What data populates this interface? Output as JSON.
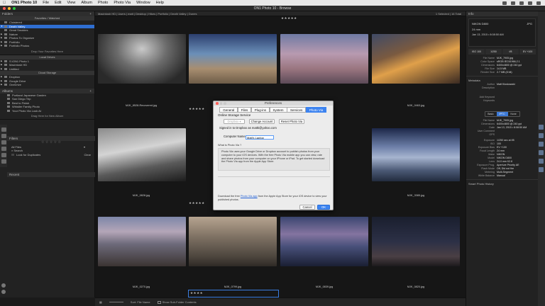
{
  "menubar": {
    "items": [
      "ON1 Photo 10",
      "File",
      "Edit",
      "View",
      "Album",
      "Photo",
      "Photo Via",
      "Window",
      "Help"
    ]
  },
  "window": {
    "title": "ON1 Photo 10 - Browse"
  },
  "left": {
    "folders_title": "Folders",
    "favorites_title": "Favorites / Watched",
    "favorites": [
      "Cloistered",
      "Death Valley",
      "Great Smokies",
      "Nature",
      "Photos To Organize",
      "Portfolio",
      "Portfolio Photos"
    ],
    "favorites_drop": "Drop Your Favorites Here",
    "local_title": "Local Drives",
    "local": [
      "S:\\ON1 Photo 1",
      "Macintosh HD",
      "Untitled"
    ],
    "cloud_title": "Cloud Storage",
    "cloud": [
      "Dropbox",
      "Google Drive",
      "OneDrive"
    ],
    "albums_title": "Albums",
    "albums": [
      "Portland Japanese Garden",
      "San Diego Trip",
      "Best to Finish",
      "Whistler Family Photo",
      "Your Photo Via Look At"
    ],
    "albums_drop": "Drag Here for New Album",
    "filters_title": "Filters",
    "filters_stars": "☆ ☆ ☆ ☆ ☆",
    "filters_any": "All Files",
    "filters_search": "Search",
    "filters_lookfor": "Look for Duplicates",
    "filters_clear": "Clear",
    "recent_title": "Recent"
  },
  "crumb": {
    "path": "Macintosh HD | Users | matt | Desktop | Hikes | Portfolio | Death Valley | Dunes",
    "count": "1 Selected | 16 Total"
  },
  "thumbs": [
    {
      "cap": "MJK_8528-Recovered.jpg",
      "stars": "★★★★★"
    },
    {
      "cap": "",
      "stars": ""
    },
    {
      "cap": "",
      "stars": ""
    },
    {
      "cap": "MJK_0463.jpg",
      "stars": ""
    },
    {
      "cap": "MJK_0828.jpg",
      "stars": "★★★★★"
    },
    {
      "cap": "",
      "stars": ""
    },
    {
      "cap": "",
      "stars": "★★★★"
    },
    {
      "cap": "MJK_3385.jpg",
      "stars": ""
    },
    {
      "cap": "MJK_0270.jpg",
      "stars": "★★★★★"
    },
    {
      "cap": "MJK_0799.jpg",
      "stars": "★★★★★"
    },
    {
      "cap": "MJK_0839.jpg",
      "stars": ""
    },
    {
      "cap": "MJK_0820.jpg",
      "stars": ""
    }
  ],
  "top_stars": "★★★★★",
  "bottom_stars": "★★★★",
  "bottombar": {
    "sort": "Sort: File Name",
    "show_sub": "Show Sub-Folder Contents"
  },
  "info": {
    "title": "Info",
    "camera": "NIKON D800",
    "filetype": "JPG",
    "lens": "24 mm",
    "date": "Jan 13, 2015 • 8:08:50 AM",
    "grid": [
      "ISO 100",
      "1/250",
      "f/8",
      "EV +100"
    ],
    "exif": [
      {
        "k": "File Name",
        "v": "MJK_7905.jpg"
      },
      {
        "k": "Color Space",
        "v": "sRGB IEC61966-2.1"
      },
      {
        "k": "Dimensions",
        "v": "6400x4800 @ 240 ppi"
      },
      {
        "k": "File Size",
        "v": "14.5 MB"
      },
      {
        "k": "Render Size",
        "v": "2.7 MB (8 bit)"
      }
    ],
    "meta_title": "Metadata",
    "meta": [
      {
        "k": "Author",
        "v": "Matt Kloskowski"
      },
      {
        "k": "Description",
        "v": ""
      },
      {
        "k": "Add Keyword",
        "v": ""
      },
      {
        "k": "Keywords",
        "v": ""
      }
    ],
    "tabs": [
      "Basic",
      "IPTC",
      "None"
    ],
    "details": [
      {
        "k": "File Name",
        "v": "MJK_7905.jpg"
      },
      {
        "k": "Dimensions",
        "v": "6400x4800 @ 240 ppi"
      },
      {
        "k": "Date",
        "v": "Jan 13, 2015 • 8:08:50 AM"
      },
      {
        "k": "User Comment",
        "v": ""
      },
      {
        "k": "GPS",
        "v": ""
      },
      {
        "k": "Exposure",
        "v": "1/250 sec at f/8"
      },
      {
        "k": "ISO",
        "v": "100"
      },
      {
        "k": "Exposure Bias",
        "v": "EV +100"
      },
      {
        "k": "Focal Length",
        "v": "24 mm"
      },
      {
        "k": "Make",
        "v": "NIKON"
      },
      {
        "k": "Model",
        "v": "NIKON D800"
      },
      {
        "k": "Lens",
        "v": "24.0 mm f/2.8"
      },
      {
        "k": "Exposure Prog.",
        "v": "Aperture Priority AE"
      },
      {
        "k": "Flash Mode",
        "v": "Off, Did not fire"
      },
      {
        "k": "Metering",
        "v": "Multi-Segment"
      },
      {
        "k": "White Balance",
        "v": "Manual"
      }
    ],
    "history_title": "Smart Photo History"
  },
  "dialog": {
    "title": "Preferences",
    "tabs": [
      "General",
      "Files",
      "Plug-ins",
      "System",
      "Services",
      "Photo Via"
    ],
    "section": "Online Storage Service",
    "service": "Dropbox",
    "change_btn": "Change Account",
    "reset_btn": "Reset Photo Via",
    "signed_in": "Signed in to Dropbox as mattk@yahoo.com",
    "computer_label": "Computer Name:",
    "computer_value": "Matt's Laptop",
    "what_title": "What is Photo Via ?",
    "what_text": "Photo Via uses your Google Drive or Dropbox account to publish photos from your computer to your iOS devices. With the free Photo Via mobile app you can view, rate and share photos from your computer on your iPhone or iPad. To get started download the Photo Via app from the Apple App Store.",
    "download_pre": "Download the free ",
    "download_link": "Photo Via app",
    "download_post": " from the Apple App Store for your iOS device to view your published photos.",
    "cancel": "Cancel",
    "ok": "OK"
  },
  "colors": {
    "accent": "#2f6ed1",
    "dialog_bg": "#ececec",
    "tab_active": "#3c83f0"
  }
}
